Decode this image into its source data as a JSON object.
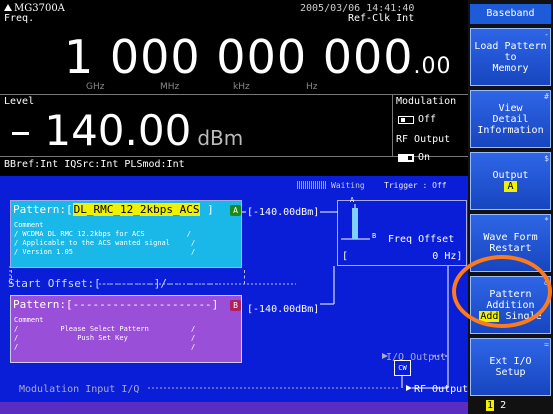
{
  "header": {
    "logo": "MG3700A",
    "datetime": "2005/03/06  14:41:40",
    "freq_label": "Freq.",
    "refclk": "Ref-Clk Int",
    "freq_main": "1 000 000 000",
    "freq_frac": ".00",
    "units": [
      "GHz",
      "MHz",
      "kHz",
      "Hz"
    ]
  },
  "level": {
    "label": "Level",
    "value": "– 140.00",
    "unit": "dBm"
  },
  "modulation": {
    "label": "Modulation",
    "state": "Off"
  },
  "rf_output": {
    "label": "RF Output",
    "state": "On"
  },
  "status": "BBref:Int   IQSrc:Int   PLSmod:Int",
  "diagram": {
    "waiting": "Waiting",
    "trigger": "Trigger : Off",
    "pattern_a": {
      "prefix": "Pattern:[",
      "name": "DL_RMC_12_2kbps_ACS",
      "suffix": " ]",
      "badge": "A",
      "comment": "Comment\n/ WCDMA DL RMC 12.2kbps for ACS          /\n/ Applicable to the ACS wanted signal     /\n/ Version 1.05                            /",
      "level": "[-140.00dBm]"
    },
    "start_offset": "Start Offset:[--------]/-- -----",
    "pattern_b": {
      "prefix": "Pattern:[",
      "name": "---------------------",
      "suffix": "]",
      "badge": "B",
      "comment": "Comment\n/          Please Select Pattern          /\n/              Push Set Key               /\n/                                         /",
      "level": "[-140.00dBm]"
    },
    "freq_offset_label": "Freq Offset",
    "freq_offset_value": "[              0 Hz]",
    "marker_a": "A",
    "marker_b": "B",
    "iq_output": "I/Q Output",
    "cw": "CW",
    "rf_output": "RF Output",
    "mod_input": "Modulation Input I/Q"
  },
  "softkeys": {
    "header": "Baseband",
    "keys": [
      {
        "line1": "Load Pattern",
        "line2": "to",
        "line3": "Memory",
        "pin": "-"
      },
      {
        "line1": "View",
        "line2": "Detail",
        "line3": "Information",
        "pin": "#"
      },
      {
        "line1": "Output",
        "value": "A",
        "pin": "$"
      },
      {
        "line1": "Wave Form",
        "line2": "Restart",
        "pin": "*"
      },
      {
        "line1": "Pattern",
        "line2": "Addition",
        "add": "Add",
        "single": "Single",
        "pin": "&"
      },
      {
        "line1": "Ext I/O",
        "line2": "Setup",
        "pin": "="
      }
    ],
    "page_current": "1",
    "page_other": "2"
  }
}
